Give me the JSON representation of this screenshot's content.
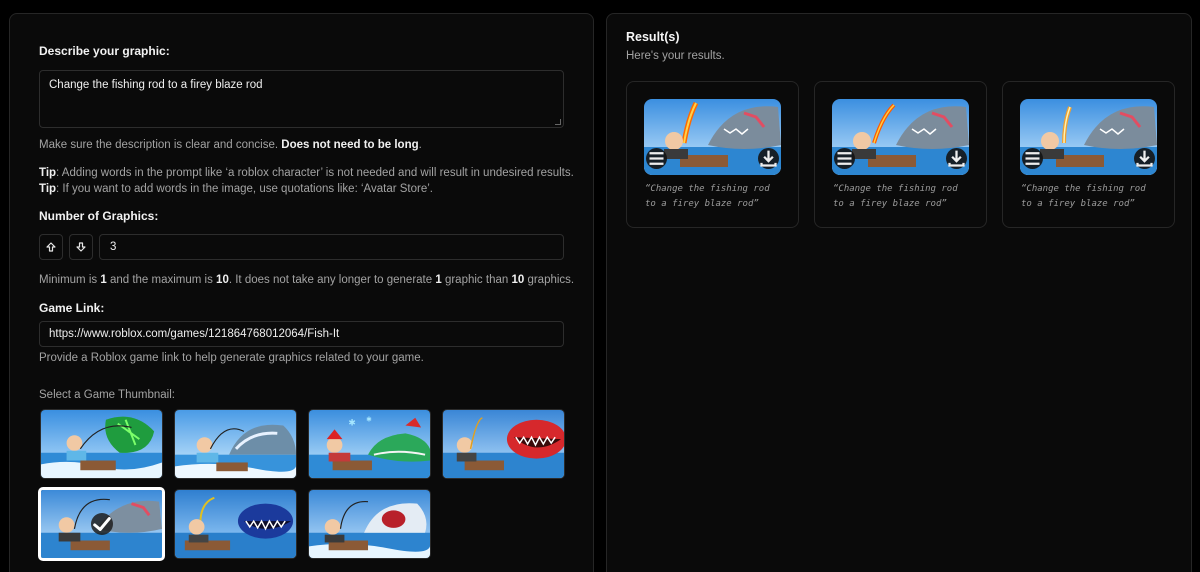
{
  "form": {
    "describe_label": "Describe your graphic:",
    "description_value": "Change the fishing rod to a firey blaze rod",
    "hint_prefix": "Make sure the description is clear and concise. ",
    "hint_bold": "Does not need to be long",
    "hint_suffix": ".",
    "tip1_label": "Tip",
    "tip1_text": ": Adding words in the prompt like ‘a roblox character’ is not needed and will result in undesired results.",
    "tip2_label": "Tip",
    "tip2_text": ": If you want to add words in the image, use quotations like: ‘Avatar Store’.",
    "count_label": "Number of Graphics:",
    "count_value": "3",
    "range_t1": "Minimum is ",
    "range_min": "1",
    "range_t2": " and the maximum is ",
    "range_max": "10",
    "range_t3": ". It does not take any longer to generate ",
    "range_one": "1",
    "range_t4": " graphic than ",
    "range_ten": "10",
    "range_t5": " graphics.",
    "link_label": "Game Link:",
    "link_value": "https://www.roblox.com/games/121864768012064/Fish-It",
    "link_hint": "Provide a Roblox game link to help generate graphics related to your game.",
    "thumbnail_label": "Select a Game Thumbnail:",
    "selected_thumbnail_index": 4
  },
  "results": {
    "title": "Result(s)",
    "subtitle": "Here's your results.",
    "items": [
      {
        "caption": "“Change the fishing rod to a firey blaze rod”"
      },
      {
        "caption": "“Change the fishing rod to a firey blaze rod”"
      },
      {
        "caption": "“Change the fishing rod to a firey blaze rod”"
      }
    ]
  },
  "icons": {
    "stepper_up": "arrow-up-icon",
    "stepper_down": "arrow-down-icon",
    "menu": "menu-icon",
    "download": "download-icon",
    "check": "check-icon"
  },
  "colors": {
    "background": "#000000",
    "panel": "#0a0a0a",
    "border": "#262626",
    "text": "#e9e9e9",
    "muted": "#a3a3a3"
  }
}
